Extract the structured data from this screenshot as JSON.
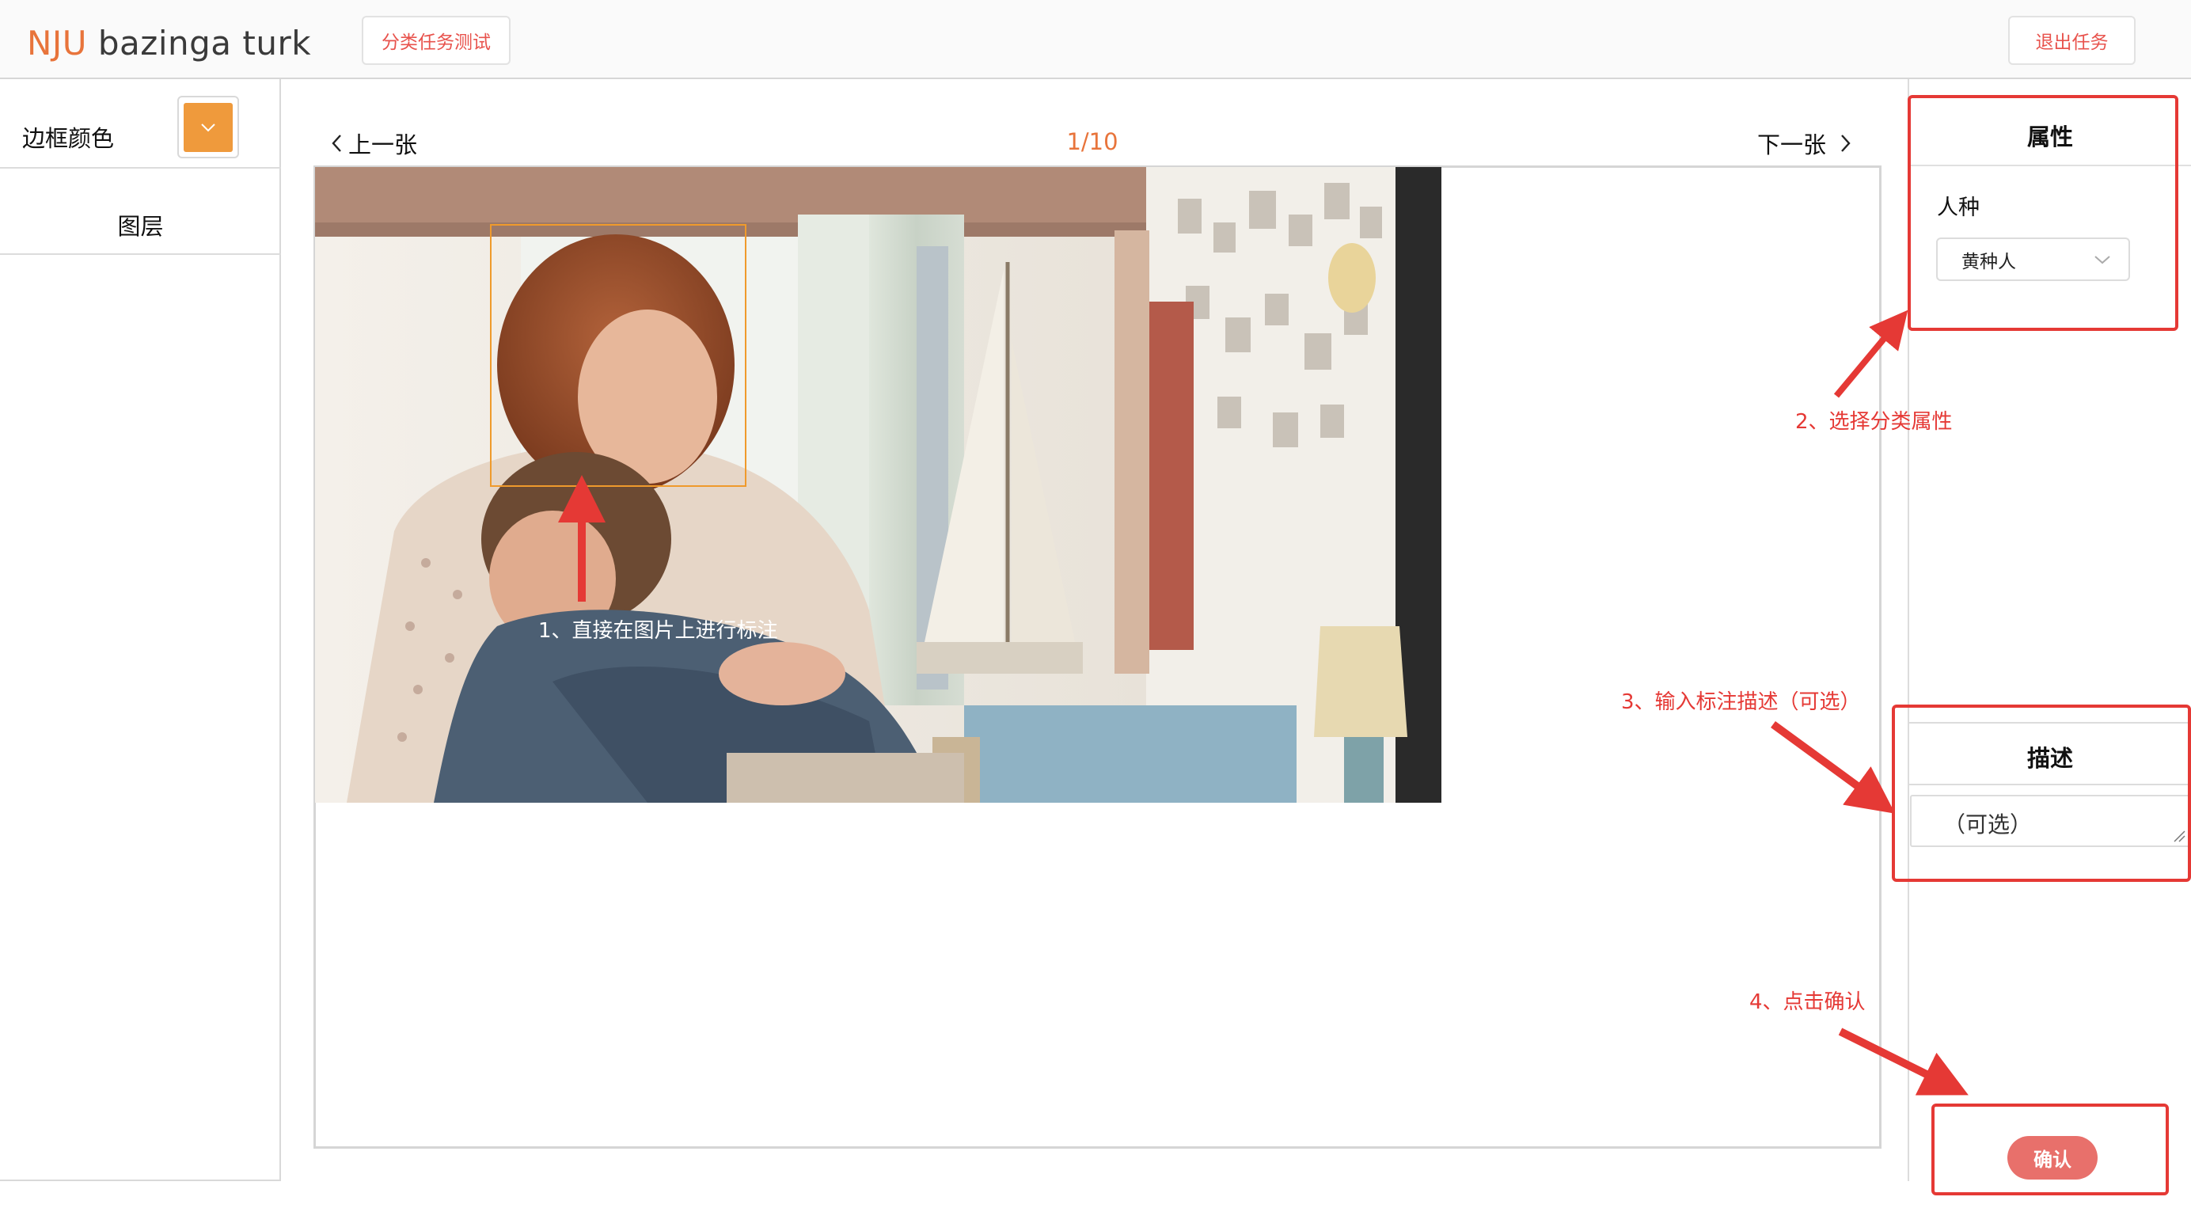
{
  "header": {
    "logo_brand": "NJU",
    "logo_rest": " bazinga turk",
    "task_button": "分类任务测试",
    "exit_button": "退出任务"
  },
  "left_panel": {
    "border_color_label": "边框颜色",
    "border_color": "#ef9a3c",
    "layers_title": "图层"
  },
  "navigation": {
    "prev_label": "上一张",
    "next_label": "下一张",
    "page_indicator": "1/10"
  },
  "right_panel": {
    "attributes_title": "属性",
    "race_label": "人种",
    "race_value": "黄种人",
    "description_title": "描述",
    "description_placeholder": "（可选）",
    "confirm_label": "确认"
  },
  "instructions": {
    "step1": "1、直接在图片上进行标注",
    "step2": "2、选择分类属性",
    "step3": "3、输入标注描述（可选）",
    "step4": "4、点击确认"
  },
  "colors": {
    "brand_orange": "#e8743b",
    "accent_red": "#e8534d",
    "instruction_red": "#e53935",
    "annotation_box": "#ef9a2c"
  },
  "icons": {
    "prev": "chevron-left-icon",
    "next": "chevron-right-icon",
    "select": "chevron-down-icon",
    "swatch": "chevron-down-icon",
    "resize": "resize-grip-icon"
  }
}
